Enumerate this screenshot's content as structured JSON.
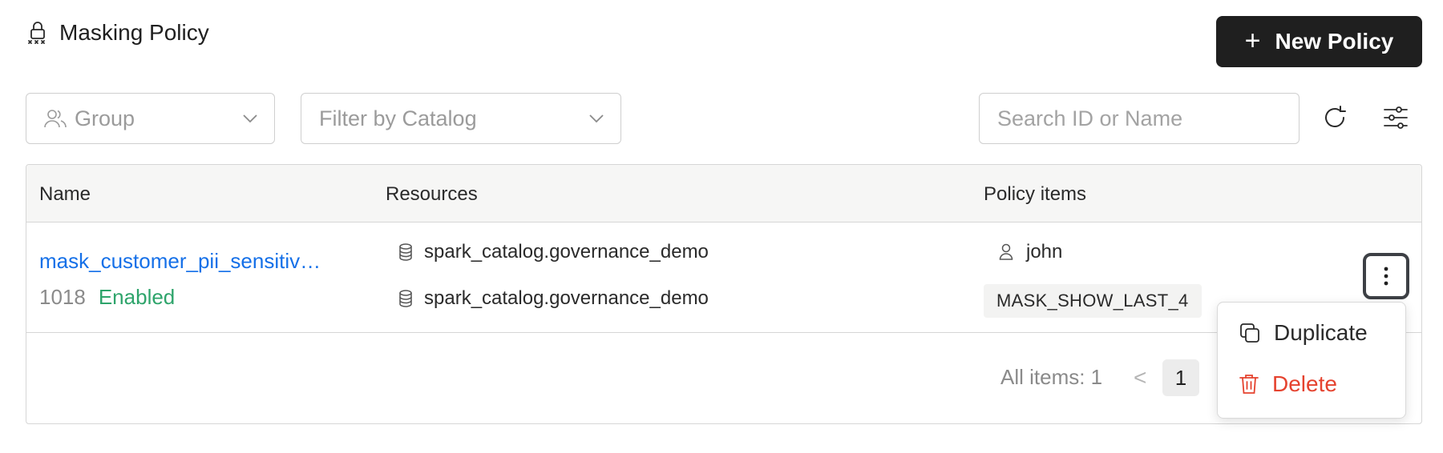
{
  "header": {
    "title": "Masking Policy",
    "title_icon": "masked-lock-icon",
    "new_button_label": "New Policy"
  },
  "filters": {
    "group_value": "Group",
    "catalog_placeholder": "Filter by Catalog",
    "search_placeholder": "Search ID or Name"
  },
  "table": {
    "columns": [
      "Name",
      "Resources",
      "Policy items"
    ],
    "rows": [
      {
        "name": "mask_customer_pii_sensitiv…",
        "id": "1018",
        "status": "Enabled",
        "resources": [
          "spark_catalog.governance_demo",
          "spark_catalog.governance_demo"
        ],
        "user": "john",
        "mask_type": "MASK_SHOW_LAST_4"
      }
    ]
  },
  "pagination": {
    "total_label": "All items: 1",
    "prev_symbol": "<",
    "current_page": "1"
  },
  "menu": {
    "duplicate_label": "Duplicate",
    "delete_label": "Delete"
  },
  "colors": {
    "primary_button": "#1f1f1f",
    "link": "#1570e8",
    "enabled": "#2ea46b",
    "delete": "#e5432f"
  }
}
